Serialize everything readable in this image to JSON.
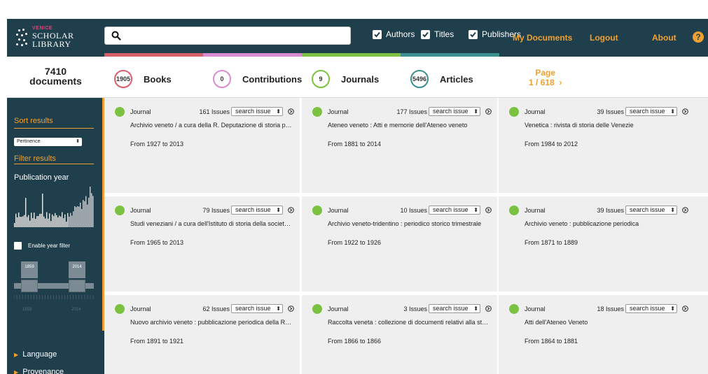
{
  "header": {
    "logo": {
      "line1": "VENICE",
      "line2": "SCHOLAR",
      "line3": "LIBRARY"
    },
    "search": {
      "value": "",
      "placeholder": ""
    },
    "filters": [
      {
        "label": "Authors",
        "checked": true
      },
      {
        "label": "Titles",
        "checked": true
      },
      {
        "label": "Publishers",
        "checked": true
      }
    ],
    "nav": {
      "my_documents": "My Documents",
      "logout": "Logout",
      "about": "About",
      "help": "?"
    },
    "colors": {
      "bar": "#1f3f4d",
      "accent": "#f0a030",
      "books": "#d65f6a",
      "contributions": "#d88bd0",
      "journals": "#7cc242",
      "articles": "#3a8f8f"
    }
  },
  "stats": {
    "doc_count": "7410",
    "doc_label": "documents",
    "items": [
      {
        "count": "1905",
        "label": "Books"
      },
      {
        "count": "0",
        "label": "Contributions"
      },
      {
        "count": "9",
        "label": "Journals"
      },
      {
        "count": "5496",
        "label": "Articles"
      }
    ],
    "page": {
      "label": "Page",
      "value": "1 / 618",
      "next": "›"
    }
  },
  "sidebar": {
    "sort_title": "Sort results",
    "sort_value": "Pertinence",
    "filter_title": "Filter results",
    "pub_year": "Publication year",
    "enable_filter": "Enable year filter",
    "year_from": "1859",
    "year_to": "2014",
    "axis_from": "1859",
    "axis_to": "2014",
    "language": "Language",
    "provenance": "Provenance"
  },
  "cards": [
    {
      "type": "Journal",
      "issues": "161 Issues",
      "select": "search issue",
      "title": "Archivio veneto / a cura della R. Deputazione di storia patria",
      "range": "From 1927 to 2013"
    },
    {
      "type": "Journal",
      "issues": "177 Issues",
      "select": "search issue",
      "title": "Ateneo veneto : Atti e memorie dell'Ateneo veneto",
      "range": "From 1881 to 2014"
    },
    {
      "type": "Journal",
      "issues": "39 Issues",
      "select": "search issue",
      "title": "Venetica : rivista di storia delle Venezie",
      "range": "From 1984 to 2012"
    },
    {
      "type": "Journal",
      "issues": "79 Issues",
      "select": "search issue",
      "title": "Studi veneziani / a cura dell'Istituto di storia della società e dello stato veneziano",
      "range": "From 1965 to 2013"
    },
    {
      "type": "Journal",
      "issues": "10 Issues",
      "select": "search issue",
      "title": "Archivio veneto-tridentino : periodico storico trimestrale",
      "range": "From 1922 to 1926"
    },
    {
      "type": "Journal",
      "issues": "39 Issues",
      "select": "search issue",
      "title": "Archivio veneto : pubblicazione periodica",
      "range": "From 1871 to 1889"
    },
    {
      "type": "Journal",
      "issues": "62 Issues",
      "select": "search issue",
      "title": "Nuovo archivio veneto : pubblicazione periodica della R. Deputazione",
      "range": "From 1891 to 1921"
    },
    {
      "type": "Journal",
      "issues": "3 Issues",
      "select": "search issue",
      "title": "Raccolta veneta : collezione di documenti relativi alla storia",
      "range": "From 1866 to 1866"
    },
    {
      "type": "Journal",
      "issues": "18 Issues",
      "select": "search issue",
      "title": "Atti dell'Ateneo Veneto",
      "range": "From 1864 to 1881"
    }
  ]
}
